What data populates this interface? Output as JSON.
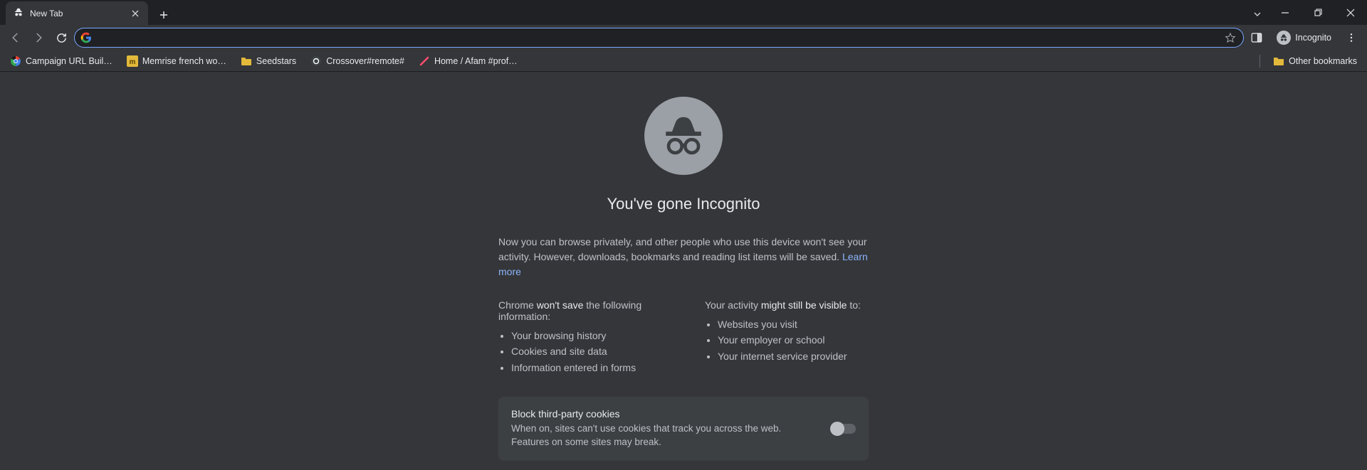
{
  "window": {
    "tab_title": "New Tab",
    "incognito_label": "Incognito"
  },
  "bookmarks": {
    "items": [
      {
        "label": "Campaign URL Buil…",
        "icon": "campaign"
      },
      {
        "label": "Memrise french wo…",
        "icon": "memrise"
      },
      {
        "label": "Seedstars",
        "icon": "folder"
      },
      {
        "label": "Crossover#remote#",
        "icon": "crossover"
      },
      {
        "label": "Home / Afam #prof…",
        "icon": "afam"
      }
    ],
    "other_label": "Other bookmarks"
  },
  "omnibox": {
    "value": "",
    "placeholder": ""
  },
  "page": {
    "title": "You've gone Incognito",
    "intro_part1": "Now you can browse privately, and other people who use this device won't see your activity. However, downloads, bookmarks and reading list items will be saved. ",
    "learn_more": "Learn more",
    "left_head_pre": "Chrome ",
    "left_head_strong": "won't save",
    "left_head_post": " the following information:",
    "left_items": [
      "Your browsing history",
      "Cookies and site data",
      "Information entered in forms"
    ],
    "right_head_pre": "Your activity ",
    "right_head_strong": "might still be visible",
    "right_head_post": " to:",
    "right_items": [
      "Websites you visit",
      "Your employer or school",
      "Your internet service provider"
    ],
    "cookie_title": "Block third-party cookies",
    "cookie_desc": "When on, sites can't use cookies that track you across the web. Features on some sites may break."
  }
}
